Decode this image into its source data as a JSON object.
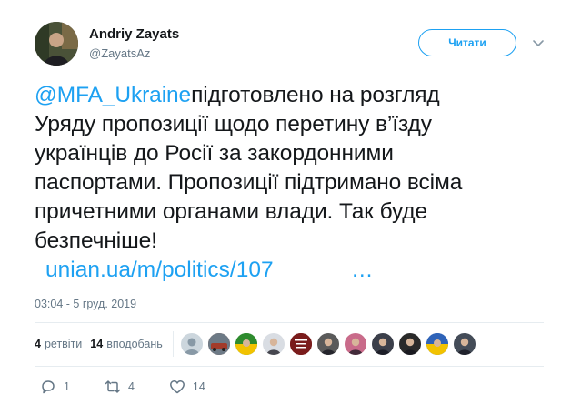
{
  "author": {
    "name": "Andriy Zayats",
    "handle": "@ZayatsAz"
  },
  "follow_button": {
    "label": "Читати"
  },
  "tweet": {
    "mention": "@MFA_Ukraine",
    "text_lines": [
      "підготовлено на розгляд",
      "Уряду пропозиції щодо перетину в’їзду",
      "українців до Росії за закордонними",
      "паспортами. Пропозиції підтримано всіма",
      "причетними органами влади. Так буде",
      "безпечніше!"
    ],
    "link": "unian.ua/m/politics/107",
    "link_ellipsis": "…",
    "timestamp": "03:04 - 5 груд. 2019"
  },
  "stats": {
    "retweets_count": "4",
    "retweets_label": "ретвіти",
    "likes_count": "14",
    "likes_label": "вподобань"
  },
  "likers": [
    {
      "icon": "default-avatar",
      "color": "#ccd6dd"
    },
    {
      "icon": "car-avatar",
      "color": "#8a4b3a"
    },
    {
      "icon": "flag-avatar",
      "color": "#2e8b2e"
    },
    {
      "icon": "person-avatar",
      "color": "#d9dde3"
    },
    {
      "icon": "text-avatar",
      "color": "#7a1c1c"
    },
    {
      "icon": "person-avatar",
      "color": "#5a5a5a"
    },
    {
      "icon": "person-avatar",
      "color": "#c96b8a"
    },
    {
      "icon": "person-avatar",
      "color": "#3b3f4a"
    },
    {
      "icon": "person-avatar",
      "color": "#2a2a2a"
    },
    {
      "icon": "flag-avatar",
      "color": "#2f63b8"
    },
    {
      "icon": "person-avatar",
      "color": "#444c58"
    }
  ],
  "actions": {
    "reply_count": "1",
    "retweet_count": "4",
    "like_count": "14"
  },
  "colors": {
    "accent": "#1da1f2",
    "text": "#14171a",
    "muted": "#657786",
    "divider": "#e6ecf0"
  }
}
